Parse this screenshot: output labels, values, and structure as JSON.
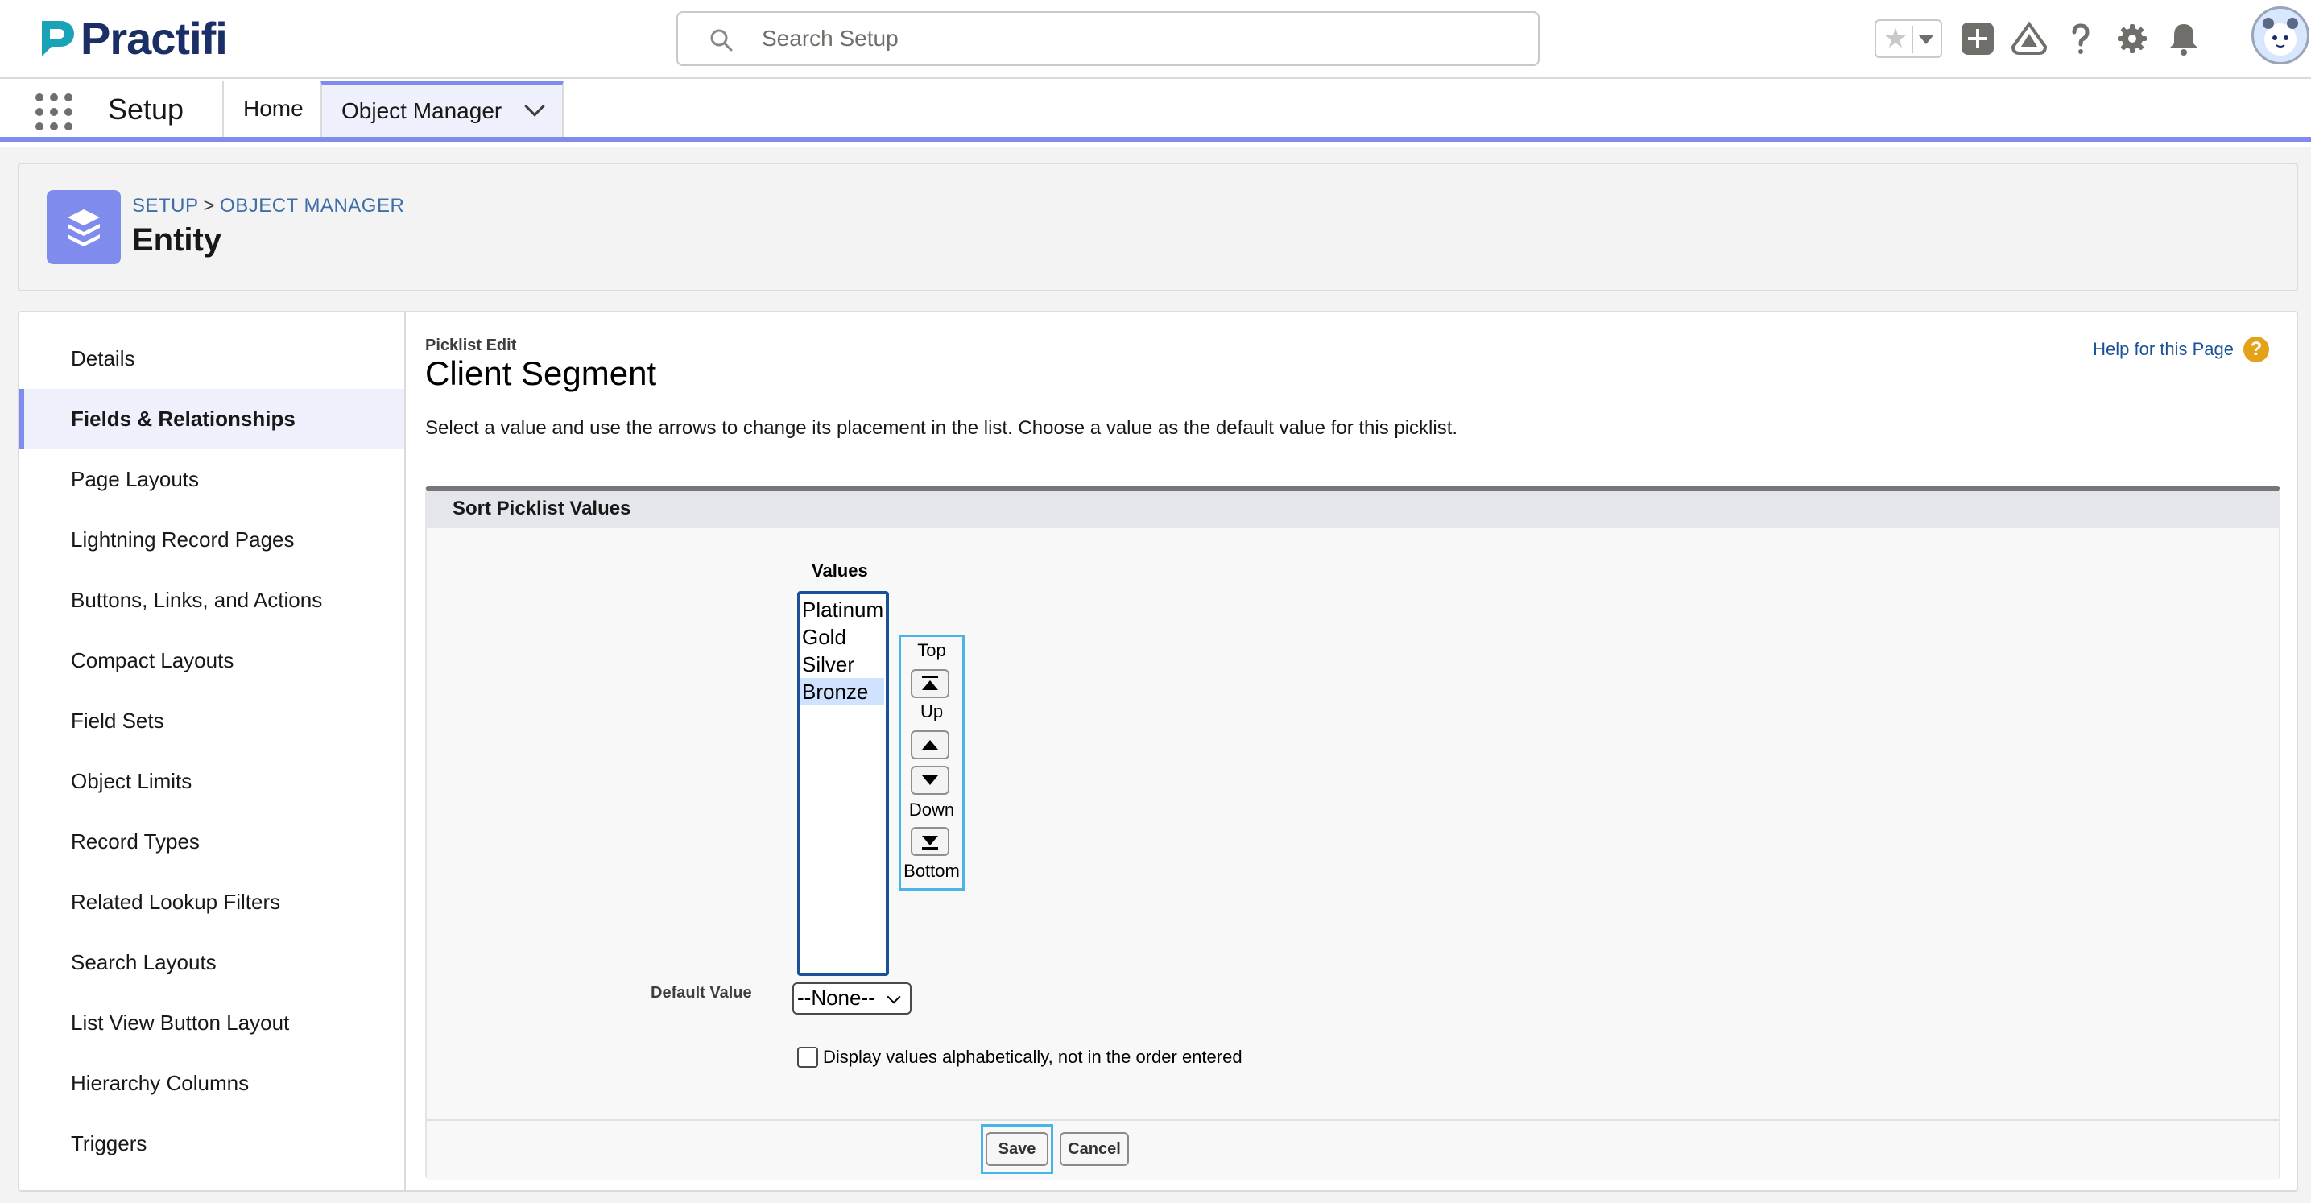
{
  "brand": {
    "name": "Practifi",
    "accent": "#1b2f66",
    "logo_accent": "#1aa3b8"
  },
  "search": {
    "placeholder": "Search Setup"
  },
  "header_icons": [
    "star-icon",
    "chevron-down-icon",
    "add-icon",
    "trailhead-icon",
    "help-icon",
    "gear-icon",
    "bell-icon",
    "avatar"
  ],
  "nav": {
    "app_name": "Setup",
    "tabs": [
      {
        "label": "Home",
        "active": false
      },
      {
        "label": "Object Manager",
        "active": true
      }
    ]
  },
  "object_header": {
    "breadcrumb": [
      "SETUP",
      "OBJECT MANAGER"
    ],
    "breadcrumb_separator": ">",
    "title": "Entity"
  },
  "sidebar": {
    "items": [
      {
        "label": "Details",
        "active": false
      },
      {
        "label": "Fields & Relationships",
        "active": true
      },
      {
        "label": "Page Layouts",
        "active": false
      },
      {
        "label": "Lightning Record Pages",
        "active": false
      },
      {
        "label": "Buttons, Links, and Actions",
        "active": false
      },
      {
        "label": "Compact Layouts",
        "active": false
      },
      {
        "label": "Field Sets",
        "active": false
      },
      {
        "label": "Object Limits",
        "active": false
      },
      {
        "label": "Record Types",
        "active": false
      },
      {
        "label": "Related Lookup Filters",
        "active": false
      },
      {
        "label": "Search Layouts",
        "active": false
      },
      {
        "label": "List View Button Layout",
        "active": false
      },
      {
        "label": "Hierarchy Columns",
        "active": false
      },
      {
        "label": "Triggers",
        "active": false
      }
    ]
  },
  "picklist": {
    "kicker": "Picklist Edit",
    "title": "Client Segment",
    "help_link": "Help for this Page",
    "instructions": "Select a value and use the arrows to change its placement in the list. Choose a value as the default value for this picklist.",
    "section_title": "Sort Picklist Values",
    "values_label": "Values",
    "values": [
      {
        "label": "Platinum",
        "selected": false
      },
      {
        "label": "Gold",
        "selected": false
      },
      {
        "label": "Silver",
        "selected": false
      },
      {
        "label": "Bronze",
        "selected": true
      }
    ],
    "arrows": {
      "top": "Top",
      "up": "Up",
      "down": "Down",
      "bottom": "Bottom"
    },
    "default_value_label": "Default Value",
    "default_value": "--None--",
    "alphabetical_label": "Display values alphabetically, not in the order entered",
    "alphabetical_checked": false,
    "save_label": "Save",
    "cancel_label": "Cancel"
  }
}
